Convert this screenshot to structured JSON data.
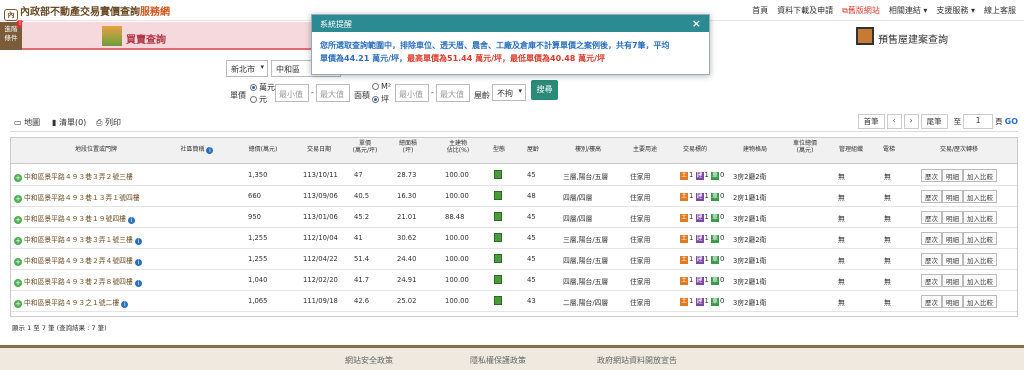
{
  "header": {
    "logo_seal": "內政部",
    "site_title": "不動產交易實價查詢",
    "site_title_sub": "服務網",
    "nav": [
      "首頁",
      "資料下載及申請",
      "舊版網站",
      "相關連結 ▾",
      "支援服務 ▾",
      "線上客服"
    ]
  },
  "tabs": {
    "side_tab": "進階條件",
    "side_badge": "!",
    "buy_tab": "買賣查詢",
    "presale_tab": "預售屋建案查詢"
  },
  "filters": {
    "city": "新北市",
    "district": "中和區",
    "price_label": "單價",
    "price_unit1": "萬元",
    "price_unit2": "元",
    "min_ph": "最小值",
    "max_ph": "最大值",
    "area_label": "面積",
    "area_unit1": "M²",
    "area_unit2": "坪",
    "age_label": "屋齡",
    "age_value": "不拘",
    "search": "搜尋"
  },
  "listbar": {
    "map": "地圖",
    "list_count": "清單(0)",
    "print": "列印",
    "first": "首筆",
    "prev": "‹",
    "next": "›",
    "last": "尾筆",
    "page_prefix": "至",
    "page_value": "1",
    "page_suffix": "頁",
    "go": "GO"
  },
  "table": {
    "headers": [
      "地段位置或門牌",
      "社區簡稱",
      "總價(萬元)",
      "交易日期",
      "單價\n(萬元/坪)",
      "總面積\n(坪)",
      "主建物\n佔比(%)",
      "型態",
      "屋齡",
      "樓別/樓高",
      "主要用途",
      "交易標的",
      "建物格局",
      "車位總價\n(萬元)",
      "管理組織",
      "電梯",
      "交易/歷次轉移"
    ],
    "rows": [
      {
        "addr": "中和區景平路４９３巷３弄２號三樓",
        "total": "1,350",
        "date": "113/10/11",
        "unit": "47",
        "area": "28.73",
        "ratio": "100.00",
        "age": "45",
        "floor": "三層,陽台/五層",
        "use": "住家用",
        "t1": "1",
        "t2": "1",
        "t3": "0",
        "layout": "3房2廳2衛",
        "mgmt": "無",
        "elev": "無",
        "info": false
      },
      {
        "addr": "中和區景平路４９３巷１３弄１號四樓",
        "total": "660",
        "date": "113/09/06",
        "unit": "40.5",
        "area": "16.30",
        "ratio": "100.00",
        "age": "48",
        "floor": "四層/四層",
        "use": "住家用",
        "t1": "1",
        "t2": "1",
        "t3": "0",
        "layout": "2房1廳1衛",
        "mgmt": "無",
        "elev": "無",
        "info": false
      },
      {
        "addr": "中和區景平路４９３巷１９號四樓",
        "total": "950",
        "date": "113/01/06",
        "unit": "45.2",
        "area": "21.01",
        "ratio": "88.48",
        "age": "45",
        "floor": "四層/四層",
        "use": "住家用",
        "t1": "1",
        "t2": "1",
        "t3": "0",
        "layout": "3房2廳1衛",
        "mgmt": "無",
        "elev": "無",
        "info": true
      },
      {
        "addr": "中和區景平路４９３巷３弄１號三樓",
        "total": "1,255",
        "date": "112/10/04",
        "unit": "41",
        "area": "30.62",
        "ratio": "100.00",
        "age": "45",
        "floor": "三層,陽台/五層",
        "use": "住家用",
        "t1": "1",
        "t2": "1",
        "t3": "0",
        "layout": "3房2廳2衛",
        "mgmt": "無",
        "elev": "無",
        "info": true
      },
      {
        "addr": "中和區景平路４９３巷２弄４號四樓",
        "total": "1,255",
        "date": "112/04/22",
        "unit": "51.4",
        "area": "24.40",
        "ratio": "100.00",
        "age": "45",
        "floor": "四層,陽台/五層",
        "use": "住家用",
        "t1": "1",
        "t2": "1",
        "t3": "0",
        "layout": "3房2廳1衛",
        "mgmt": "無",
        "elev": "無",
        "info": true
      },
      {
        "addr": "中和區景平路４９３巷２弄８號四樓",
        "total": "1,040",
        "date": "112/02/20",
        "unit": "41.7",
        "area": "24.91",
        "ratio": "100.00",
        "age": "45",
        "floor": "四層,陽台/五層",
        "use": "住家用",
        "t1": "1",
        "t2": "1",
        "t3": "0",
        "layout": "3房2廳1衛",
        "mgmt": "無",
        "elev": "無",
        "info": true
      },
      {
        "addr": "中和區景平路４９３之１號二樓",
        "total": "1,065",
        "date": "111/09/18",
        "unit": "42.6",
        "area": "25.02",
        "ratio": "100.00",
        "age": "43",
        "floor": "二層,陽台/四層",
        "use": "住家用",
        "t1": "1",
        "t2": "1",
        "t3": "0",
        "layout": "3房2廳1衛",
        "mgmt": "無",
        "elev": "無",
        "info": true
      }
    ],
    "btn_history": "歷次",
    "btn_detail": "明細",
    "btn_compare": "加入比較",
    "footer_text": "顯示 1 至 7 筆 (查詢結果 : 7 筆)"
  },
  "footer": {
    "links": [
      "網站安全政策",
      "隱私權保護政策",
      "政府網站資料開放宣告"
    ]
  },
  "modal": {
    "title": "系統提醒",
    "close": "×",
    "msg1": "您所選取查詢範圍中，排除車位、透天厝、農舍、工廠及倉庫不計算單價之案例後，共有7筆，平均",
    "msg2_a": "單價為44.21 萬元/坪，",
    "msg2_b": "最高單價為51.44 萬元/坪，最低單價為40.48 萬元/坪"
  },
  "colors": {
    "brand": "#2b8a92",
    "accent_red": "#d83a2a",
    "buy_tab": "#f6d9dd",
    "footer": "#efe9df"
  }
}
